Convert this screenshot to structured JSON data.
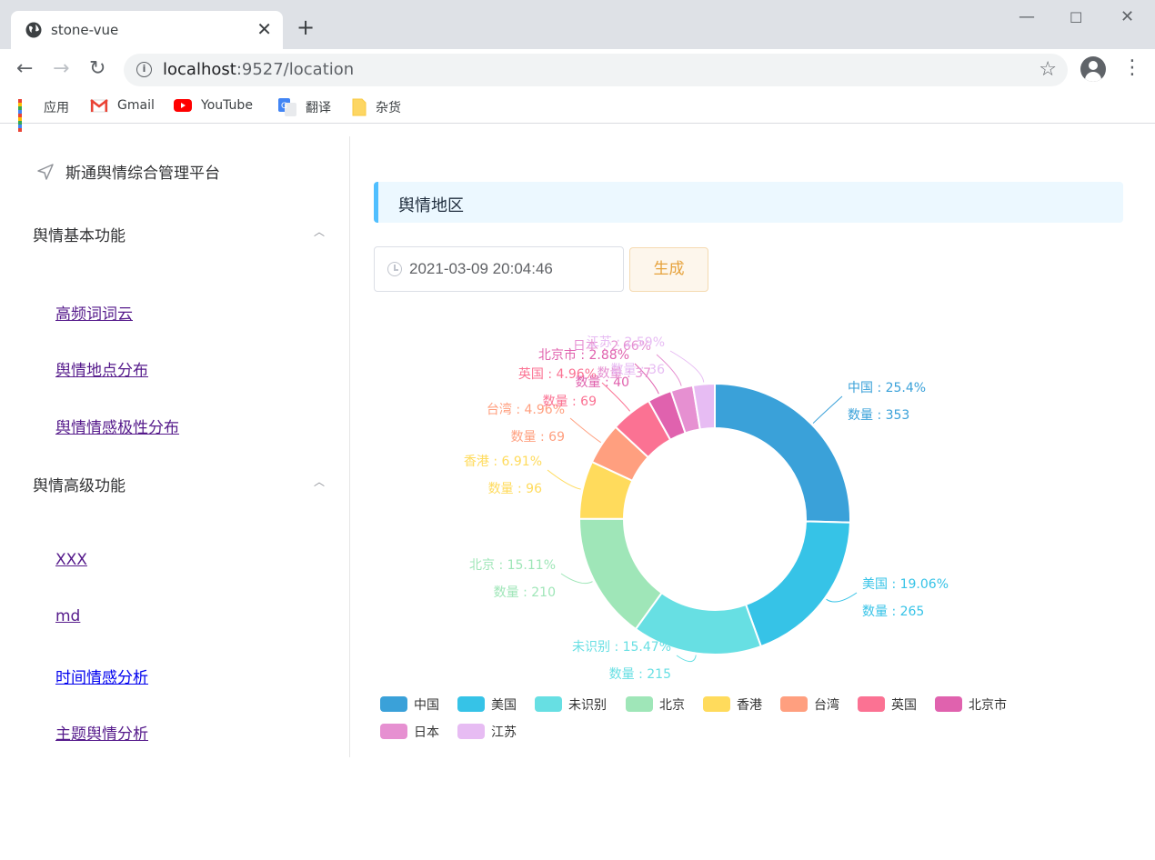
{
  "browser": {
    "tab_title": "stone-vue",
    "url_host": "localhost",
    "url_rest": ":9527/location",
    "bookmarks": [
      "应用",
      "Gmail",
      "YouTube",
      "翻译",
      "杂货"
    ]
  },
  "sidebar": {
    "brand": "斯通舆情综合管理平台",
    "groups": [
      {
        "title": "舆情基本功能",
        "items": [
          "高频词词云",
          "舆情地点分布",
          "舆情情感极性分布"
        ]
      },
      {
        "title": "舆情高级功能",
        "items": [
          "XXX",
          "md",
          "时间情感分析",
          "主题舆情分析"
        ]
      }
    ]
  },
  "main": {
    "section_title": "舆情地区",
    "date_value": "2021-03-09 20:04:46",
    "generate_label": "生成"
  },
  "chart_data": {
    "type": "pie",
    "variant": "donut",
    "legend_position": "bottom-left",
    "count_label": "数量",
    "series": [
      {
        "name": "中国",
        "value": 353,
        "percent": "25.4%",
        "color": "#3aa1d9"
      },
      {
        "name": "美国",
        "value": 265,
        "percent": "19.06%",
        "color": "#36c3e7"
      },
      {
        "name": "未识别",
        "value": 215,
        "percent": "15.47%",
        "color": "#67dfe3"
      },
      {
        "name": "北京",
        "value": 210,
        "percent": "15.11%",
        "color": "#9fe6b8"
      },
      {
        "name": "香港",
        "value": 96,
        "percent": "6.91%",
        "color": "#ffdb5c"
      },
      {
        "name": "台湾",
        "value": 69,
        "percent": "4.96%",
        "color": "#ff9f7f"
      },
      {
        "name": "英国",
        "value": 69,
        "percent": "4.96%",
        "color": "#fb7293"
      },
      {
        "name": "北京市",
        "value": 40,
        "percent": "2.88%",
        "color": "#e062ae"
      },
      {
        "name": "日本",
        "value": 37,
        "percent": "2.66%",
        "color": "#e690d1"
      },
      {
        "name": "江苏",
        "value": 36,
        "percent": "2.59%",
        "color": "#e7bcf3"
      }
    ]
  }
}
